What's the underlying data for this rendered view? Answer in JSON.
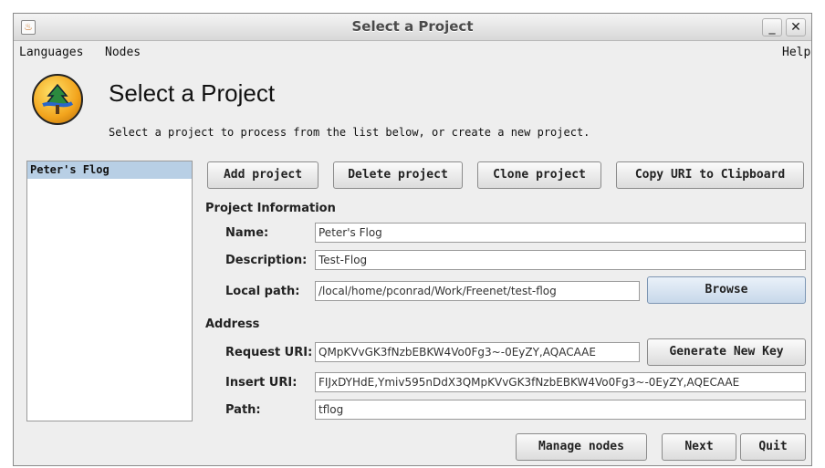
{
  "window": {
    "title": "Select a Project",
    "app_icon": "java-cup-icon"
  },
  "titlebar_buttons": {
    "minimize": "_",
    "close": "✕"
  },
  "menu": {
    "languages": "Languages",
    "nodes": "Nodes",
    "help": "Help"
  },
  "header": {
    "title": "Select a Project",
    "subtitle": "Select a project to process from the list below, or create a new project."
  },
  "projects": [
    {
      "label": "Peter's Flog",
      "selected": true
    }
  ],
  "toolbar": {
    "add_label": "Add project",
    "delete_label": "Delete project",
    "clone_label": "Clone project",
    "copy_uri_label": "Copy URI to Clipboard"
  },
  "project_info": {
    "section_label": "Project Information",
    "name_label": "Name:",
    "name_value": "Peter's Flog",
    "description_label": "Description:",
    "description_value": "Test-Flog",
    "local_path_label": "Local path:",
    "local_path_value": "/local/home/pconrad/Work/Freenet/test-flog",
    "browse_label": "Browse"
  },
  "address": {
    "section_label": "Address",
    "request_uri_label": "Request URI:",
    "request_uri_value": "QMpKVvGK3fNzbEBKW4Vo0Fg3~-0EyZY,AQACAAE",
    "generate_label": "Generate New Key",
    "insert_uri_label": "Insert URI:",
    "insert_uri_value": "FIJxDYHdE,Ymiv595nDdX3QMpKVvGK3fNzbEBKW4Vo0Fg3~-0EyZY,AQECAAE",
    "path_label": "Path:",
    "path_value": "tflog"
  },
  "footer": {
    "manage_nodes_label": "Manage nodes",
    "next_label": "Next",
    "quit_label": "Quit"
  }
}
